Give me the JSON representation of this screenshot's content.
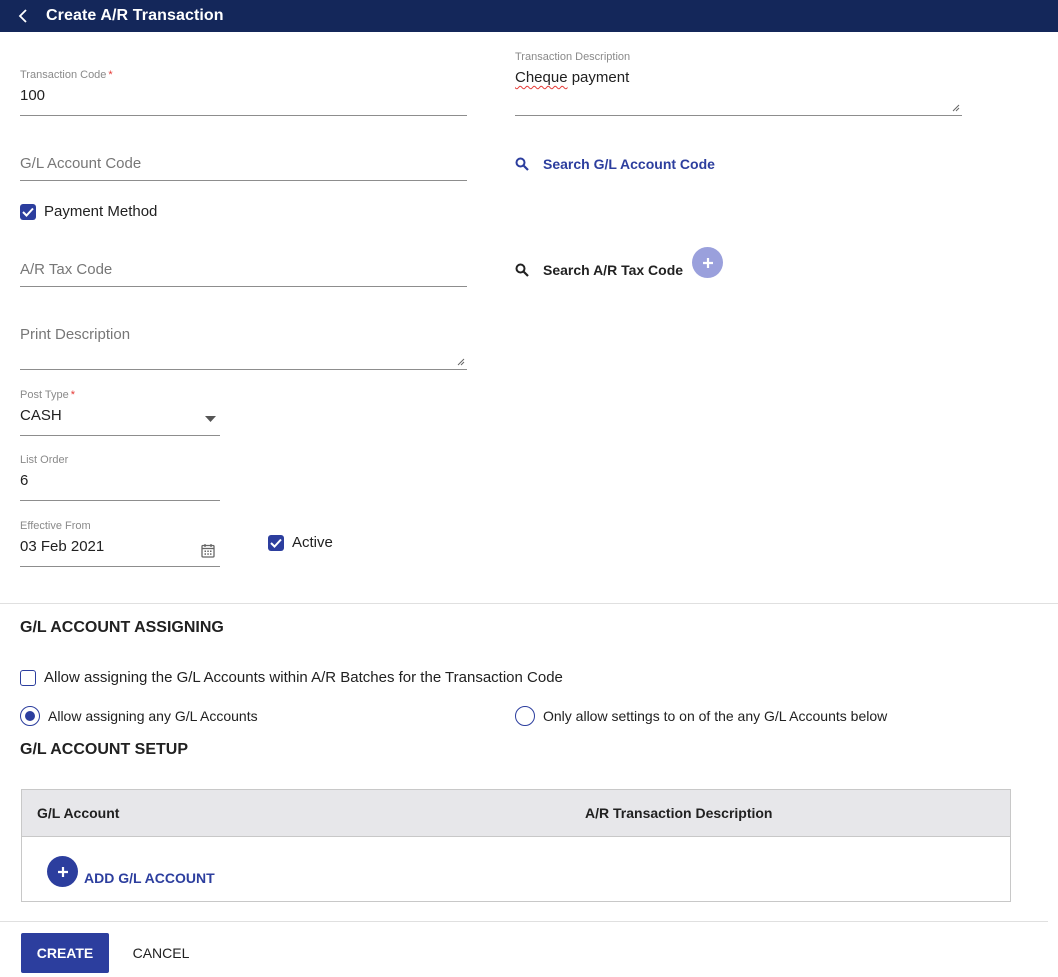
{
  "header": {
    "title": "Create A/R Transaction",
    "back_icon": "chevron-left-icon"
  },
  "form": {
    "transaction_code": {
      "label": "Transaction Code",
      "required_mark": "*",
      "value": "100"
    },
    "transaction_description": {
      "label": "Transaction Description",
      "value_word1": "Cheque",
      "value_rest": " payment"
    },
    "gl_account_code": {
      "placeholder": "G/L Account Code"
    },
    "search_gl": {
      "label": "Search G/L Account Code",
      "icon": "search-icon"
    },
    "payment_method": {
      "label": "Payment Method",
      "checked": true
    },
    "ar_tax_code": {
      "placeholder": "A/R Tax Code"
    },
    "search_tax": {
      "label": "Search A/R Tax Code",
      "icon": "search-icon"
    },
    "print_description": {
      "placeholder": "Print Description"
    },
    "post_type": {
      "label": "Post Type",
      "required_mark": "*",
      "value": "CASH"
    },
    "list_order": {
      "label": "List Order",
      "value": "6"
    },
    "effective_from": {
      "label": "Effective From",
      "value": "03 Feb 2021"
    },
    "active": {
      "label": "Active",
      "checked": true
    }
  },
  "assigning": {
    "title": "G/L ACCOUNT ASSIGNING",
    "allow_in_batches": {
      "label": "Allow assigning the G/L Accounts within A/R Batches for the Transaction Code",
      "checked": false
    },
    "radio_any": {
      "label": "Allow assigning any G/L Accounts",
      "selected": true
    },
    "radio_only": {
      "label": "Only allow settings to on of the any G/L Accounts below",
      "selected": false
    }
  },
  "setup": {
    "title": "G/L ACCOUNT SETUP",
    "columns": [
      "G/L Account",
      "A/R Transaction Description"
    ],
    "add_label": "ADD G/L ACCOUNT"
  },
  "actions": {
    "create": "CREATE",
    "cancel": "CANCEL"
  },
  "colors": {
    "header_bg": "#14275a",
    "accent": "#2c3e9e",
    "fab_light": "#9aa0dc",
    "required": "#e53935"
  }
}
